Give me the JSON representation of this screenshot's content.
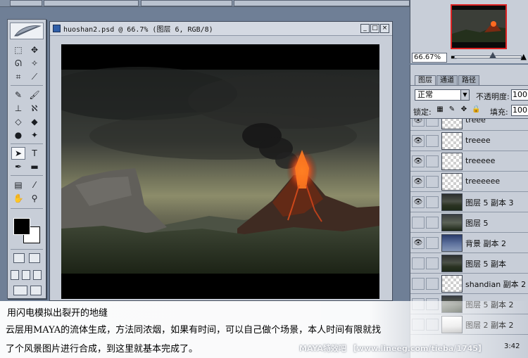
{
  "document": {
    "title": "huoshan2.psd @ 66.7% (图层 6, RGB/8)",
    "window_buttons": [
      "_",
      "□",
      "×"
    ]
  },
  "toolbox": {
    "tools": [
      "marquee-tool",
      "move-tool",
      "lasso-tool",
      "magic-wand-tool",
      "crop-tool",
      "slice-tool",
      "healing-brush-tool",
      "brush-tool",
      "clone-stamp-tool",
      "history-brush-tool",
      "eraser-tool",
      "paint-bucket-tool",
      "dodge-tool",
      "burn-tool",
      "path-select-tool",
      "type-tool",
      "pen-tool",
      "shape-tool",
      "notes-tool",
      "eyedropper-tool",
      "hand-tool",
      "zoom-tool"
    ]
  },
  "navigator": {
    "zoom": "66.67%"
  },
  "layers": {
    "tabs": [
      "图层",
      "通道",
      "路径"
    ],
    "blend_mode": "正常",
    "opacity_label": "不透明度:",
    "opacity_value": "100",
    "lock_label": "锁定:",
    "fill_label": "填充:",
    "fill_value": "100",
    "rows": [
      {
        "name": "treee",
        "visible": true,
        "thumb": "checker"
      },
      {
        "name": "treeee",
        "visible": true,
        "thumb": "checker"
      },
      {
        "name": "treeeee",
        "visible": true,
        "thumb": "checker"
      },
      {
        "name": "treeeeee",
        "visible": true,
        "thumb": "checker"
      },
      {
        "name": "图层 5 副本 3",
        "visible": true,
        "thumb": "scene"
      },
      {
        "name": "图层 5",
        "visible": false,
        "thumb": "scene2"
      },
      {
        "name": "背景 副本 2",
        "visible": true,
        "thumb": "sky"
      },
      {
        "name": "图层 5 副本",
        "visible": false,
        "thumb": "scene"
      },
      {
        "name": "shandian 副本 2",
        "visible": false,
        "thumb": "checker"
      },
      {
        "name": "图层 5 副本 2",
        "visible": false,
        "thumb": "scene2"
      },
      {
        "name": "图层 2 副本 2",
        "visible": false,
        "thumb": "white"
      }
    ]
  },
  "caption": {
    "line1": "用闪电模拟出裂开的地缝",
    "line2": "云层用MAYA的流体生成，方法同浓烟，如果有时间，可以自己做个场景，本人时间有限就找",
    "line3": "了个风景图片进行合成，到这里就基本完成了。"
  },
  "watermark": "MAYA特效吧 【www.lineeg.com/tieba/1745】",
  "timestamp": "3:42",
  "colors": {
    "foreground": "#000000",
    "background": "#ffffff",
    "lava": "#e8501c"
  }
}
